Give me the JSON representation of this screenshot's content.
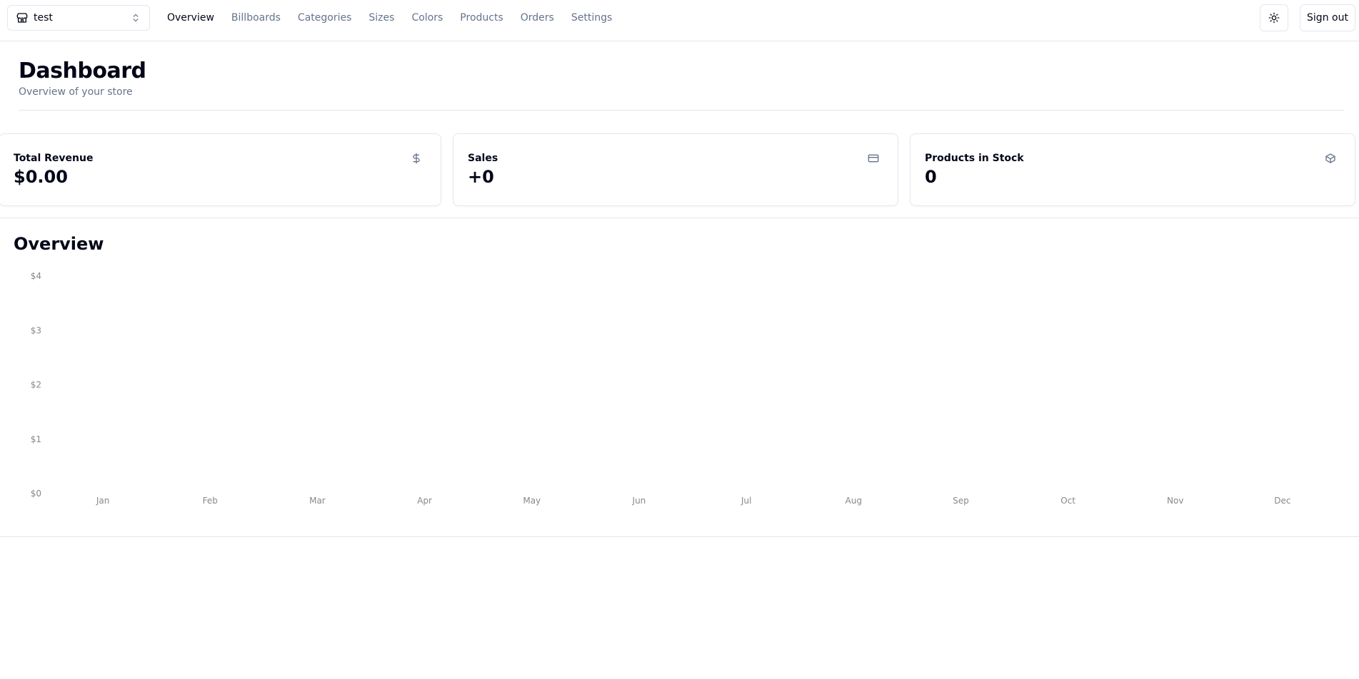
{
  "store": {
    "name": "test"
  },
  "nav": {
    "links": [
      "Overview",
      "Billboards",
      "Categories",
      "Sizes",
      "Colors",
      "Products",
      "Orders",
      "Settings"
    ],
    "active": "Overview"
  },
  "header": {
    "signout_label": "Sign out"
  },
  "page": {
    "title": "Dashboard",
    "subtitle": "Overview of your store"
  },
  "cards": [
    {
      "label": "Total Revenue",
      "value": "$0.00",
      "icon": "dollar-sign-icon"
    },
    {
      "label": "Sales",
      "value": "+0",
      "icon": "credit-card-icon"
    },
    {
      "label": "Products in Stock",
      "value": "0",
      "icon": "package-icon"
    }
  ],
  "chart": {
    "title": "Overview"
  },
  "chart_data": {
    "type": "bar",
    "title": "Overview",
    "categories": [
      "Jan",
      "Feb",
      "Mar",
      "Apr",
      "May",
      "Jun",
      "Jul",
      "Aug",
      "Sep",
      "Oct",
      "Nov",
      "Dec"
    ],
    "values": [
      0,
      0,
      0,
      0,
      0,
      0,
      0,
      0,
      0,
      0,
      0,
      0
    ],
    "ylim": [
      0,
      4
    ],
    "yticks": [
      "$0",
      "$1",
      "$2",
      "$3",
      "$4"
    ],
    "xlabel": "",
    "ylabel": "",
    "grid": false,
    "bar_color": "#adfa1d"
  },
  "colors": {
    "muted_text": "#64748b",
    "border": "#e2e8f0",
    "foreground": "#020617"
  }
}
